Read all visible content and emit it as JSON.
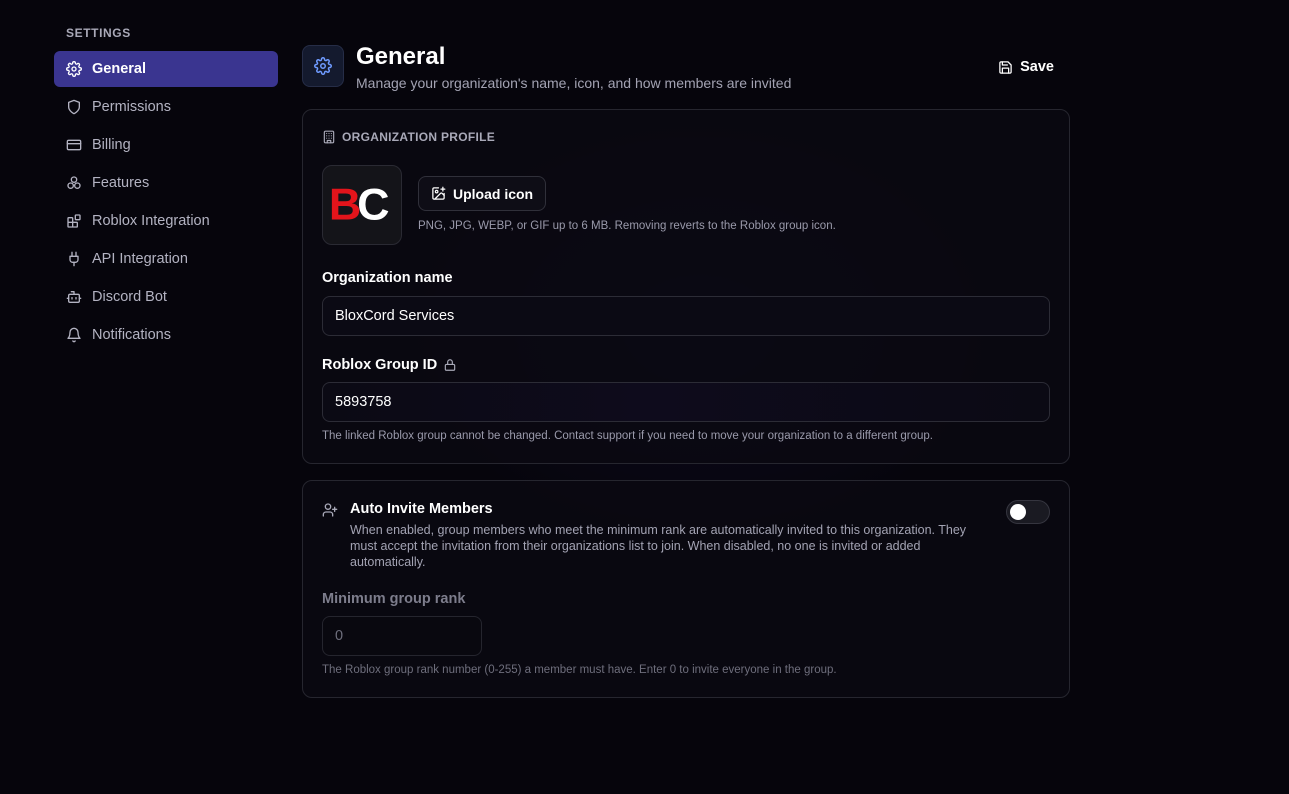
{
  "sidebar": {
    "heading": "SETTINGS",
    "items": [
      {
        "label": "General",
        "icon": "gear-icon",
        "active": true
      },
      {
        "label": "Permissions",
        "icon": "shield-icon"
      },
      {
        "label": "Billing",
        "icon": "credit-card-icon"
      },
      {
        "label": "Features",
        "icon": "boxes-icon"
      },
      {
        "label": "Roblox Integration",
        "icon": "blocks-icon"
      },
      {
        "label": "API Integration",
        "icon": "plug-icon"
      },
      {
        "label": "Discord Bot",
        "icon": "bot-icon"
      },
      {
        "label": "Notifications",
        "icon": "bell-icon"
      }
    ]
  },
  "header": {
    "title": "General",
    "subtitle": "Manage your organization's name, icon, and how members are invited",
    "save_label": "Save"
  },
  "profile": {
    "section_title": "ORGANIZATION PROFILE",
    "logo_text": "BC",
    "upload_label": "Upload icon",
    "upload_hint": "PNG, JPG, WEBP, or GIF up to 6 MB. Removing reverts to the Roblox group icon.",
    "name_label": "Organization name",
    "name_value": "BloxCord Services",
    "group_id_label": "Roblox Group ID",
    "group_id_value": "5893758",
    "group_id_hint": "The linked Roblox group cannot be changed. Contact support if you need to move your organization to a different group."
  },
  "invite": {
    "title": "Auto Invite Members",
    "description": "When enabled, group members who meet the minimum rank are automatically invited to this organization. They must accept the invitation from their organizations list to join. When disabled, no one is invited or added automatically.",
    "enabled": false,
    "rank_label": "Minimum group rank",
    "rank_value": "0",
    "rank_hint": "The Roblox group rank number (0-255) a member must have. Enter 0 to invite everyone in the group."
  },
  "colors": {
    "accent": "#3a3590",
    "logo_red": "#e3141b",
    "background": "#06050c"
  }
}
